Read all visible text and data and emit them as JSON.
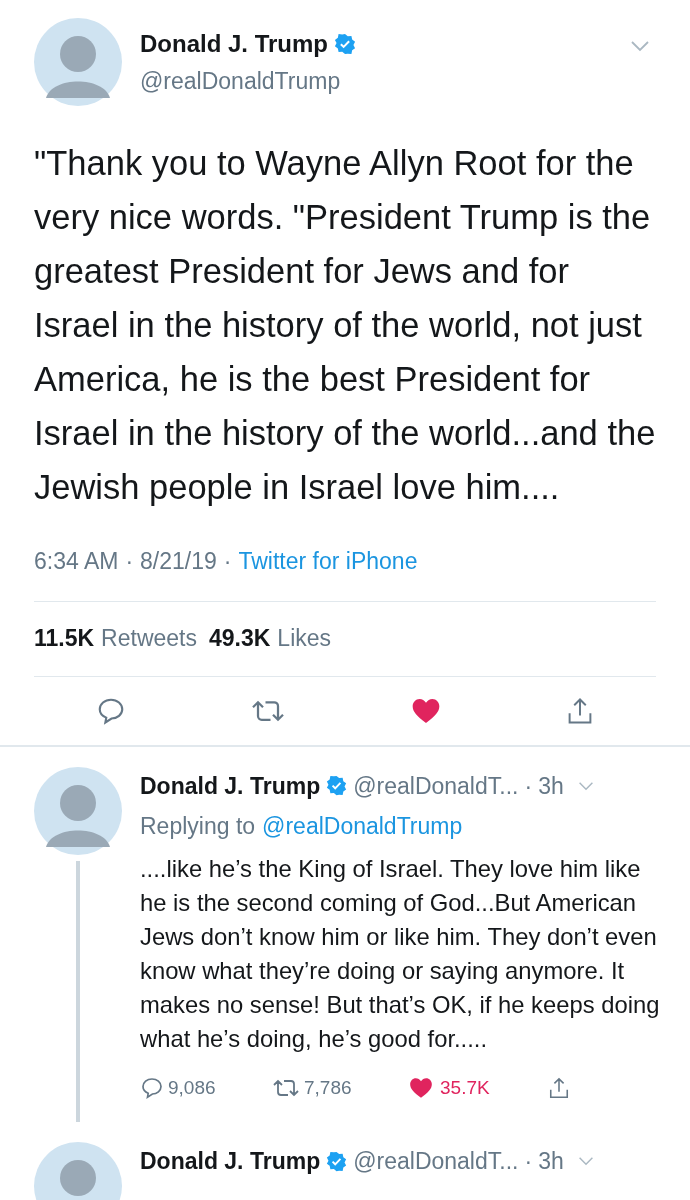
{
  "main_tweet": {
    "name": "Donald J. Trump",
    "verified": true,
    "handle": "@realDonaldTrump",
    "text": "\"Thank you to Wayne Allyn Root for the very nice words. \"President Trump is the greatest President for Jews and for Israel in the history of the world, not just America, he is the best President for Israel in the history of the world...and the Jewish people in Israel love him....",
    "time": "6:34 AM",
    "separator": "·",
    "date": "8/21/19",
    "source": "Twitter for iPhone",
    "retweets": "11.5K",
    "retweets_label": "Retweets",
    "likes": "49.3K",
    "likes_label": "Likes",
    "liked": true
  },
  "replies": [
    {
      "name": "Donald J. Trump",
      "verified": true,
      "handle": "@realDonaldT...",
      "separator": "·",
      "age": "3h",
      "replying_label": "Replying to",
      "replying_to": "@realDonaldTrump",
      "text": "....like he’s the King of Israel. They love him like he is the second coming of God...But American Jews don’t know him or like him. They don’t even know what they’re doing or saying anymore. It makes no sense! But that’s OK, if he keeps doing what he’s doing, he’s good for.....",
      "replies": "9,086",
      "retweets": "7,786",
      "likes": "35.7K",
      "liked": true
    },
    {
      "name": "Donald J. Trump",
      "verified": true,
      "handle": "@realDonaldT...",
      "separator": "·",
      "age": "3h"
    }
  ]
}
